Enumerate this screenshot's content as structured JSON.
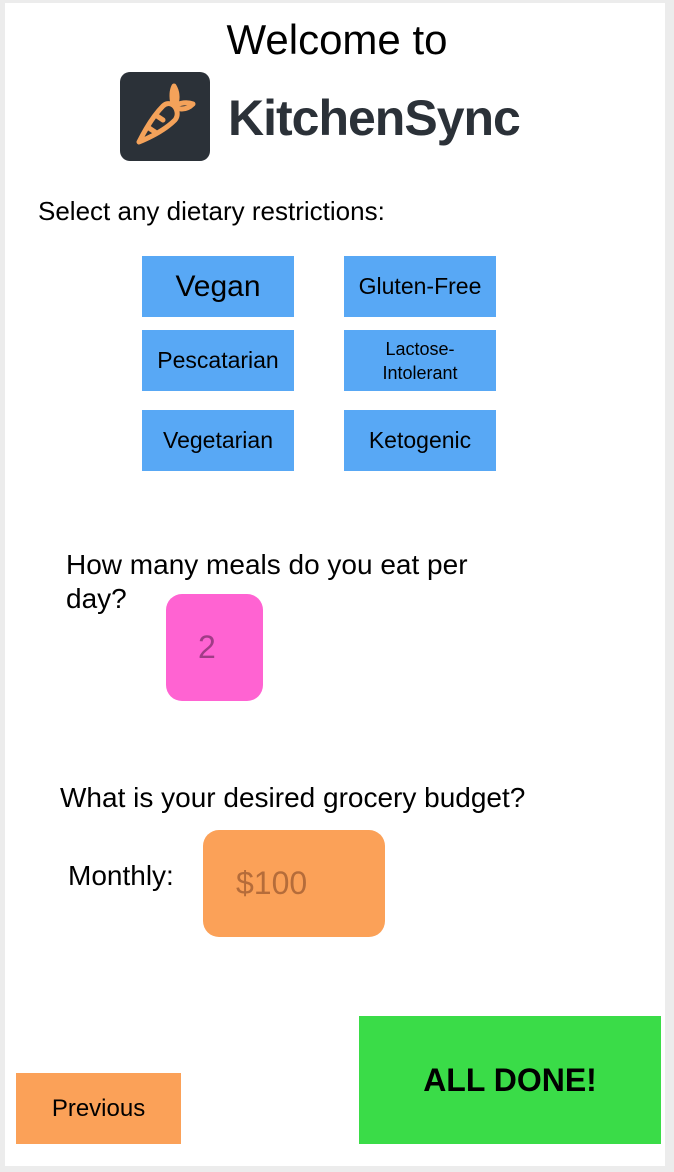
{
  "header": {
    "welcome": "Welcome to",
    "brand": "KitchenSync",
    "logo_icon": "carrot-icon"
  },
  "diet": {
    "prompt": "Select any dietary restrictions:",
    "options": [
      "Vegan",
      "Gluten-Free",
      "Pescatarian",
      "Lactose-\nIntolerant",
      "Vegetarian",
      "Ketogenic"
    ]
  },
  "meals": {
    "question": "How many meals do you eat per day?",
    "placeholder": "2"
  },
  "budget": {
    "question": "What is your desired grocery budget?",
    "monthly_label": "Monthly:",
    "placeholder": "$100"
  },
  "footer": {
    "previous_label": "Previous",
    "done_label": "ALL DONE!"
  },
  "colors": {
    "option_blue": "#58a8f5",
    "meals_pink": "#ff63d2",
    "budget_orange": "#fba158",
    "done_green": "#3adc48",
    "logo_dark": "#2b3138",
    "carrot_orange": "#f4a25a"
  }
}
